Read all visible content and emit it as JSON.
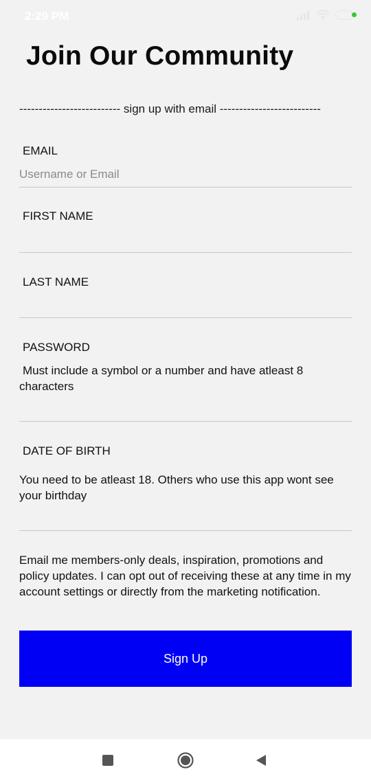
{
  "status_bar": {
    "time": "2:29 PM",
    "icons": [
      "signal-icon",
      "wifi-icon",
      "battery-icon"
    ]
  },
  "title": "Join Our Community",
  "divider_label": "-------------------------- sign up with email --------------------------",
  "fields": {
    "email": {
      "label": "EMAIL",
      "placeholder": "Username or Email",
      "value": ""
    },
    "first_name": {
      "label": "FIRST NAME",
      "value": ""
    },
    "last_name": {
      "label": "LAST NAME",
      "value": ""
    },
    "password": {
      "label": "PASSWORD",
      "hint": "Must include a symbol or a number and have atleast 8 characters",
      "value": ""
    },
    "date_of_birth": {
      "label": "DATE OF BIRTH",
      "hint": "You need to be atleast 18. Others who use this app wont see your birthday",
      "value": ""
    }
  },
  "consent_text": "Email me members-only deals, inspiration, promotions and policy updates. I can opt out of receiving these at any time in my account settings or directly from the marketing notification.",
  "signup_button_label": "Sign Up",
  "nav_bar": {
    "buttons": [
      "recents-square-icon",
      "home-circle-icon",
      "back-triangle-icon"
    ]
  },
  "colors": {
    "background": "#f2f2f2",
    "button": "#0000f5",
    "button_text": "#ffffff",
    "battery_indicator": "#3ec43e"
  }
}
